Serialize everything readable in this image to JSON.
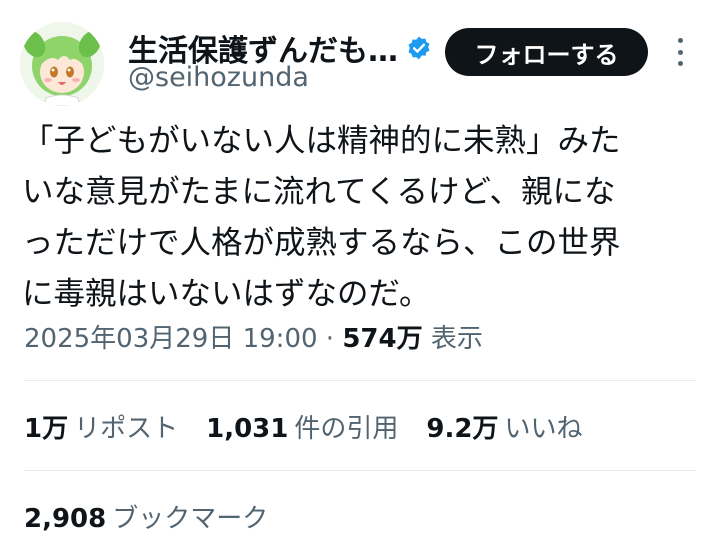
{
  "author": {
    "display_name": "生活保護ずんだも…",
    "handle": "@seihozunda",
    "avatar_icon": "anime-character-avatar-icon",
    "verified_icon": "verified-badge-icon"
  },
  "follow_button": {
    "label": "フォローする"
  },
  "more_button": {
    "icon": "more-vertical-icon"
  },
  "tweet": {
    "text": "「子どもがいない人は精神的に未熟」みた\nいな意見がたまに流れてくるけど、親にな\nっただけで人格が成熟するなら、この世界\nに毒親はいないはずなのだ。"
  },
  "meta": {
    "timestamp": "2025年03月29日 19:00",
    "separator": " · ",
    "views_count": "574万",
    "views_label": "表示"
  },
  "stats": {
    "reposts_count": "1万",
    "reposts_label": "リポスト",
    "quotes_count": "1,031",
    "quotes_label": "件の引用",
    "likes_count": "9.2万",
    "likes_label": "いいね"
  },
  "bookmarks": {
    "count": "2,908",
    "label": "ブックマーク"
  },
  "colors": {
    "text": "#0f1419",
    "secondary": "#536471",
    "verified": "#1d9bf0",
    "button_bg": "#0f1419",
    "divider": "#e6ecf0"
  }
}
